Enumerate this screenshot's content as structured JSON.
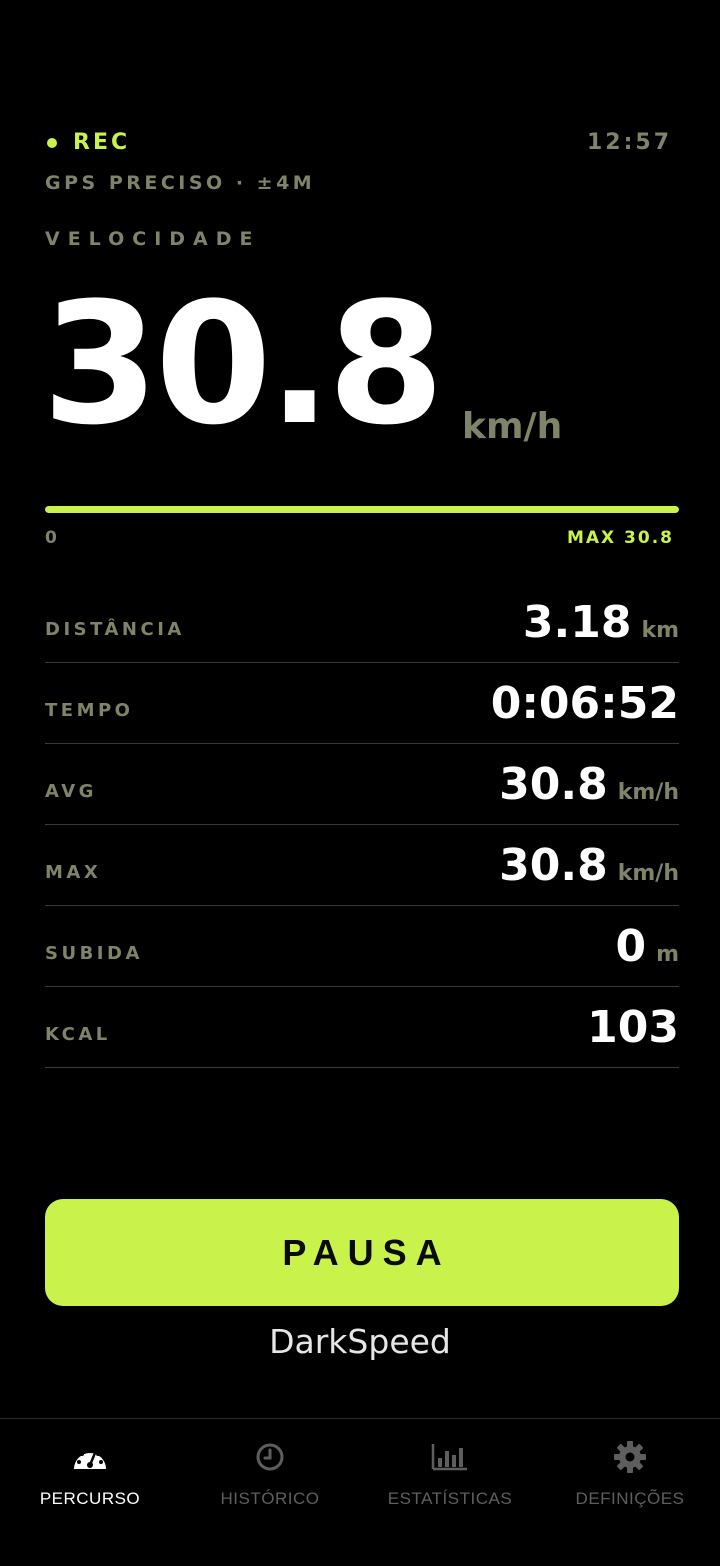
{
  "status": {
    "rec_label": "REC",
    "clock": "12:57",
    "gps_text": "GPS PRECISO · ±4M"
  },
  "speed": {
    "label": "VELOCIDADE",
    "value": "30.8",
    "unit": "km/h",
    "bar_min": "0",
    "bar_max_label": "MAX 30.8",
    "bar_fill_percent": 100
  },
  "stats": [
    {
      "label": "DISTÂNCIA",
      "value": "3.18",
      "unit": "km"
    },
    {
      "label": "TEMPO",
      "value": "0:06:52",
      "unit": ""
    },
    {
      "label": "AVG",
      "value": "30.8",
      "unit": "km/h"
    },
    {
      "label": "MAX",
      "value": "30.8",
      "unit": "km/h"
    },
    {
      "label": "SUBIDA",
      "value": "0",
      "unit": "m"
    },
    {
      "label": "KCAL",
      "value": "103",
      "unit": ""
    }
  ],
  "pause_label": "PAUSA",
  "brand": "DarkSpeed",
  "tabs": [
    {
      "label": "PERCURSO",
      "icon": "speedometer-icon",
      "active": true
    },
    {
      "label": "HISTÓRICO",
      "icon": "clock-icon",
      "active": false
    },
    {
      "label": "ESTATÍSTICAS",
      "icon": "bar-chart-icon",
      "active": false
    },
    {
      "label": "DEFINIÇÕES",
      "icon": "gear-icon",
      "active": false
    }
  ],
  "colors": {
    "accent": "#c9f24b",
    "muted": "#7d8468",
    "background": "#000000"
  }
}
